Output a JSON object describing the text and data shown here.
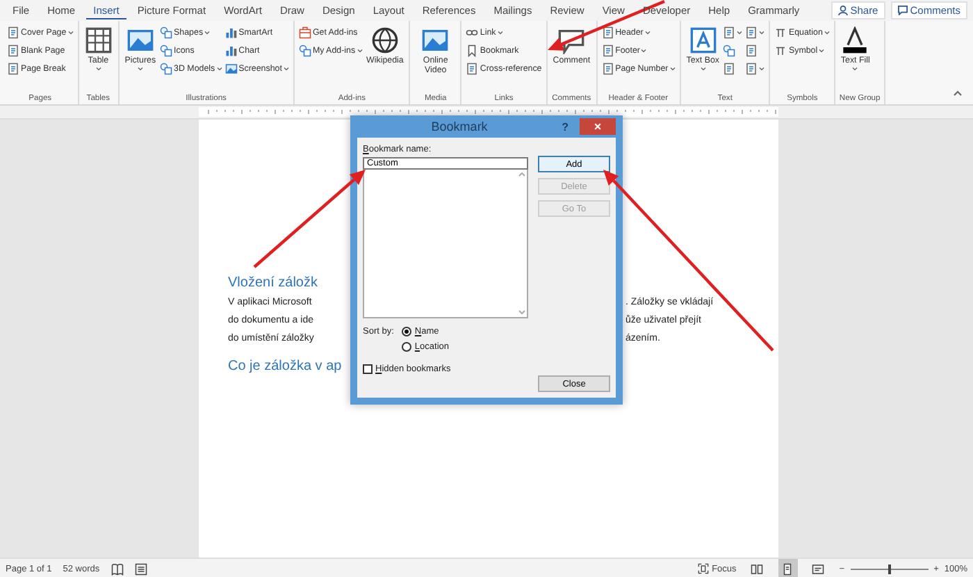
{
  "tabs": [
    {
      "label": "File",
      "selected": false
    },
    {
      "label": "Home",
      "selected": false
    },
    {
      "label": "Insert",
      "selected": true
    },
    {
      "label": "Picture Format",
      "selected": false
    },
    {
      "label": "WordArt",
      "selected": false
    },
    {
      "label": "Draw",
      "selected": false
    },
    {
      "label": "Design",
      "selected": false
    },
    {
      "label": "Layout",
      "selected": false
    },
    {
      "label": "References",
      "selected": false
    },
    {
      "label": "Mailings",
      "selected": false
    },
    {
      "label": "Review",
      "selected": false
    },
    {
      "label": "View",
      "selected": false
    },
    {
      "label": "Developer",
      "selected": false
    },
    {
      "label": "Help",
      "selected": false
    },
    {
      "label": "Grammarly",
      "selected": false
    }
  ],
  "share_button": "Share",
  "comments_button": "Comments",
  "ribbon_groups": [
    {
      "label": "Pages",
      "items": [
        {
          "label": "Cover Page",
          "kind": "small",
          "dropdown": true
        },
        {
          "label": "Blank Page",
          "kind": "small",
          "dropdown": false
        },
        {
          "label": "Page Break",
          "kind": "small",
          "dropdown": false
        }
      ]
    },
    {
      "label": "Tables",
      "items": [
        {
          "label": "Table",
          "kind": "large",
          "dropdown": true
        }
      ]
    },
    {
      "label": "Illustrations",
      "items": [
        {
          "label": "Pictures",
          "kind": "large",
          "dropdown": true
        },
        {
          "label": "Shapes",
          "kind": "small",
          "dropdown": true
        },
        {
          "label": "Icons",
          "kind": "small",
          "dropdown": false
        },
        {
          "label": "3D Models",
          "kind": "small",
          "dropdown": true
        },
        {
          "label": "SmartArt",
          "kind": "small",
          "dropdown": false
        },
        {
          "label": "Chart",
          "kind": "small",
          "dropdown": false
        },
        {
          "label": "Screenshot",
          "kind": "small",
          "dropdown": true
        }
      ]
    },
    {
      "label": "Add-ins",
      "items": [
        {
          "label": "Get Add-ins",
          "kind": "small",
          "dropdown": false
        },
        {
          "label": "My Add-ins",
          "kind": "small",
          "dropdown": true
        },
        {
          "label": "Wikipedia",
          "kind": "large",
          "dropdown": false
        }
      ]
    },
    {
      "label": "Media",
      "items": [
        {
          "label": "Online Video",
          "kind": "large",
          "dropdown": false
        }
      ]
    },
    {
      "label": "Links",
      "items": [
        {
          "label": "Link",
          "kind": "small",
          "dropdown": true
        },
        {
          "label": "Bookmark",
          "kind": "small",
          "dropdown": false
        },
        {
          "label": "Cross-reference",
          "kind": "small",
          "dropdown": false
        }
      ]
    },
    {
      "label": "Comments",
      "items": [
        {
          "label": "Comment",
          "kind": "large",
          "dropdown": false
        }
      ]
    },
    {
      "label": "Header & Footer",
      "items": [
        {
          "label": "Header",
          "kind": "small",
          "dropdown": true
        },
        {
          "label": "Footer",
          "kind": "small",
          "dropdown": true
        },
        {
          "label": "Page Number",
          "kind": "small",
          "dropdown": true
        }
      ]
    },
    {
      "label": "Text",
      "items": [
        {
          "label": "Text Box",
          "kind": "large",
          "dropdown": true
        },
        {
          "kind": "small",
          "dropdown": true
        },
        {
          "kind": "small",
          "dropdown": false
        },
        {
          "kind": "small",
          "dropdown": false
        },
        {
          "kind": "small",
          "dropdown": true
        },
        {
          "kind": "small",
          "dropdown": false
        },
        {
          "kind": "small",
          "dropdown": true
        }
      ]
    },
    {
      "label": "Symbols",
      "items": [
        {
          "label": "Equation",
          "kind": "small",
          "dropdown": true
        },
        {
          "label": "Symbol",
          "kind": "small",
          "dropdown": true
        }
      ]
    },
    {
      "label": "New Group",
      "items": [
        {
          "label": "Text Fill",
          "kind": "large",
          "dropdown": true
        }
      ]
    }
  ],
  "document": {
    "rows": [
      {
        "kind": "heading",
        "left": "Vložení záložk"
      },
      {
        "kind": "body",
        "left": "V aplikaci Microsoft",
        "right": ". Záložky se vkládají"
      },
      {
        "kind": "body",
        "left": "do dokumentu a ide",
        "right": "ůže uživatel přejít"
      },
      {
        "kind": "body",
        "left": "do umístění záložky",
        "right": "ázením."
      },
      {
        "kind": "heading",
        "left": "Co je záložka v ap"
      }
    ]
  },
  "dialog": {
    "title": "Bookmark",
    "help": "?",
    "close": "×",
    "name_label": "Bookmark name:",
    "name_value": "Custom",
    "sort_label": "Sort by:",
    "sort_options": [
      {
        "label": "Name",
        "selected": true
      },
      {
        "label": "Location",
        "selected": false
      }
    ],
    "hidden_bookmarks": {
      "label": "Hidden bookmarks",
      "checked": false
    },
    "buttons": [
      {
        "label": "Add",
        "disabled": false
      },
      {
        "label": "Delete",
        "disabled": true
      },
      {
        "label": "Go To",
        "disabled": true
      }
    ],
    "close_button": "Close"
  },
  "annotations": [
    {
      "kind": "arrow"
    },
    {
      "kind": "arrow"
    },
    {
      "kind": "arrow"
    }
  ],
  "status_bar": {
    "page": "Page 1 of 1",
    "words": "52 words",
    "focus": "Focus",
    "views": [
      {
        "selected": false
      },
      {
        "selected": true
      },
      {
        "selected": false
      }
    ],
    "zoom": {
      "minus": "−",
      "plus": "+",
      "level": 0.5,
      "reading": "100%"
    }
  }
}
